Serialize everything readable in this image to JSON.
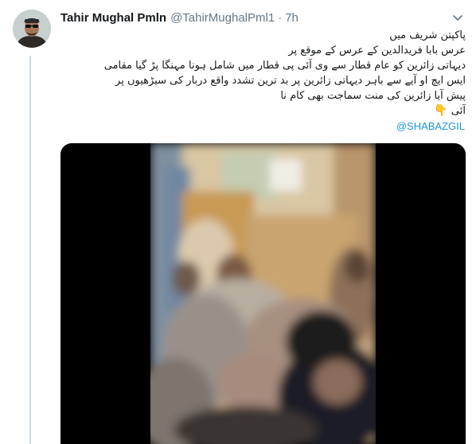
{
  "tweet": {
    "author_name": "Tahir Mughal Pmln",
    "author_handle": "@TahirMughalPml1",
    "separator": "·",
    "timestamp": "7h",
    "text_lines": [
      "پاکپتن شریف میں",
      "عرس بابا فریدالدین کے عرس کے موقع پر",
      "دیہاتی زائرین کو عام قطار سے وی آئی پی قطار میں شامل ہونا مہنگا پڑ گیا مقامی",
      "ایس ایچ او آیے سے باہر دیہاتی زائرین پر بد ترین تشدد واقع دربار کی سیڑھیوں پر",
      "پیش آیا زائرین کی منت سماجت بھی کام نا",
      "آئی"
    ],
    "emoji": "👇",
    "mention": "@SHABAZGIL"
  },
  "icons": {
    "menu": "chevron-down-icon",
    "avatar": "user-avatar"
  },
  "colors": {
    "link": "#1b95e0",
    "secondary_text": "#657786",
    "thread_line": "#ccd6dd"
  }
}
